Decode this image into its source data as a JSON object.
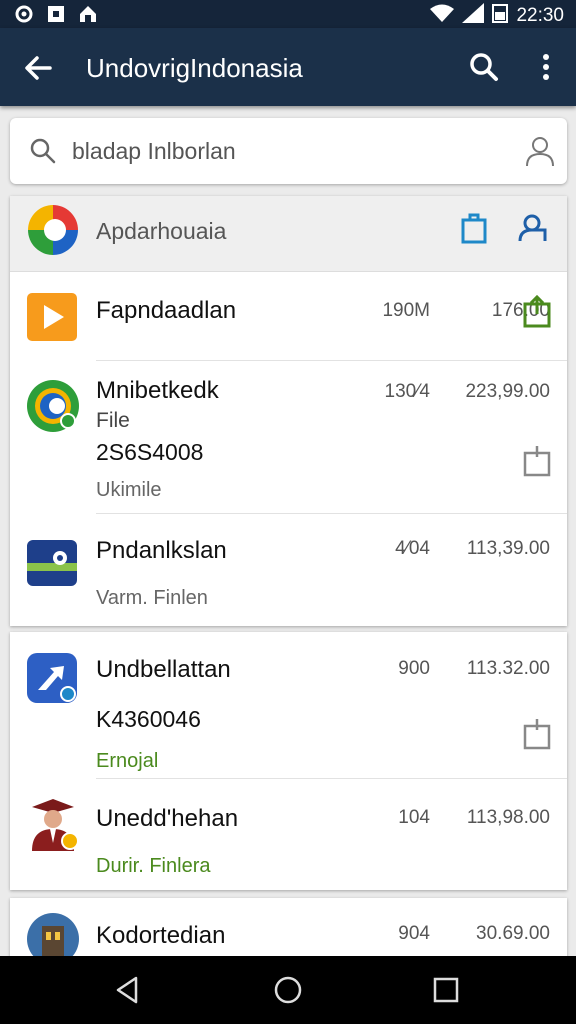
{
  "status_bar": {
    "time": "22:30"
  },
  "app_bar": {
    "title": "UndovrigIndonasia"
  },
  "search": {
    "text": "bladap Inlborlan"
  },
  "card_header": {
    "title": "Apdarhouaia"
  },
  "items": [
    {
      "name": "Fapndaadlan",
      "size": "190M",
      "price": "176.00",
      "icon": "play-app-icon"
    },
    {
      "name": "Mnibetkedk",
      "line2": "File",
      "number": "2S6S4008",
      "sub": "Ukimile",
      "size": "130⁄4",
      "price": "223,99.00",
      "icon": "circle-app-icon"
    },
    {
      "name": "Pndanlkslan",
      "sub": "Varm. Finlen",
      "size": "4⁄04",
      "price": "113,39.00",
      "icon": "card-app-icon"
    },
    {
      "name": "Undbellattan",
      "number": "K4360046",
      "sub": "Ernojal",
      "size": "900",
      "price": "113.32.00",
      "icon": "arrow-app-icon"
    },
    {
      "name": "Unedd'hehan",
      "sub": "Durir. Finlera",
      "size": "104",
      "price": "113,98.00",
      "icon": "portrait-app-icon"
    },
    {
      "name": "Kodortedian",
      "size": "904",
      "price": "30.69.00",
      "icon": "tower-app-icon"
    }
  ],
  "colors": {
    "app_bar": "#1b3049",
    "status_bar": "#15253a",
    "accent_green": "#4b8a1e",
    "accent_blue": "#1e88c8"
  }
}
